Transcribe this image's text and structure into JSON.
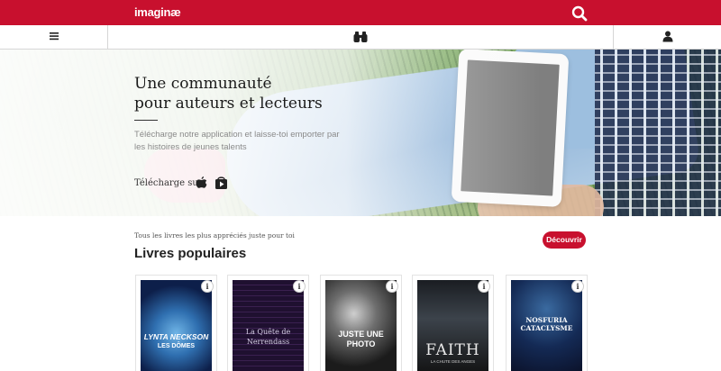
{
  "header": {
    "logo": "imaginæ",
    "search_icon": "search-icon",
    "brand_color": "#c8102e"
  },
  "nav": {
    "menu_icon": "hamburger-menu-icon",
    "explore_icon": "binoculars-icon",
    "user_icon": "user-icon"
  },
  "hero": {
    "title": "Une communauté\npour auteurs et lecteurs",
    "subtitle": "Télécharge notre application et laisse-toi emporter par les histoires de jeunes talents",
    "download_label": "Télécharge sur",
    "stores": [
      "apple-store-icon",
      "google-play-icon"
    ]
  },
  "section": {
    "subtitle": "Tous les livres les plus appréciés juste pour toi",
    "title": "Livres populaires",
    "discover_label": "Découvrir"
  },
  "books": [
    {
      "cover_title": "LYNTA NECKSON",
      "cover_subtitle": "LES DÔMES",
      "info_label": "i"
    },
    {
      "cover_title": "La Quête de Nerrendass",
      "cover_subtitle": "",
      "info_label": "i"
    },
    {
      "cover_title": "JUSTE UNE PHOTO",
      "cover_subtitle": "",
      "info_label": "i"
    },
    {
      "cover_title": "FAITH",
      "cover_subtitle": "LA CHUTE DES ANGES",
      "info_label": "i"
    },
    {
      "cover_title": "NOSFURIA CATACLYSME",
      "cover_subtitle": "",
      "info_label": "i"
    }
  ]
}
